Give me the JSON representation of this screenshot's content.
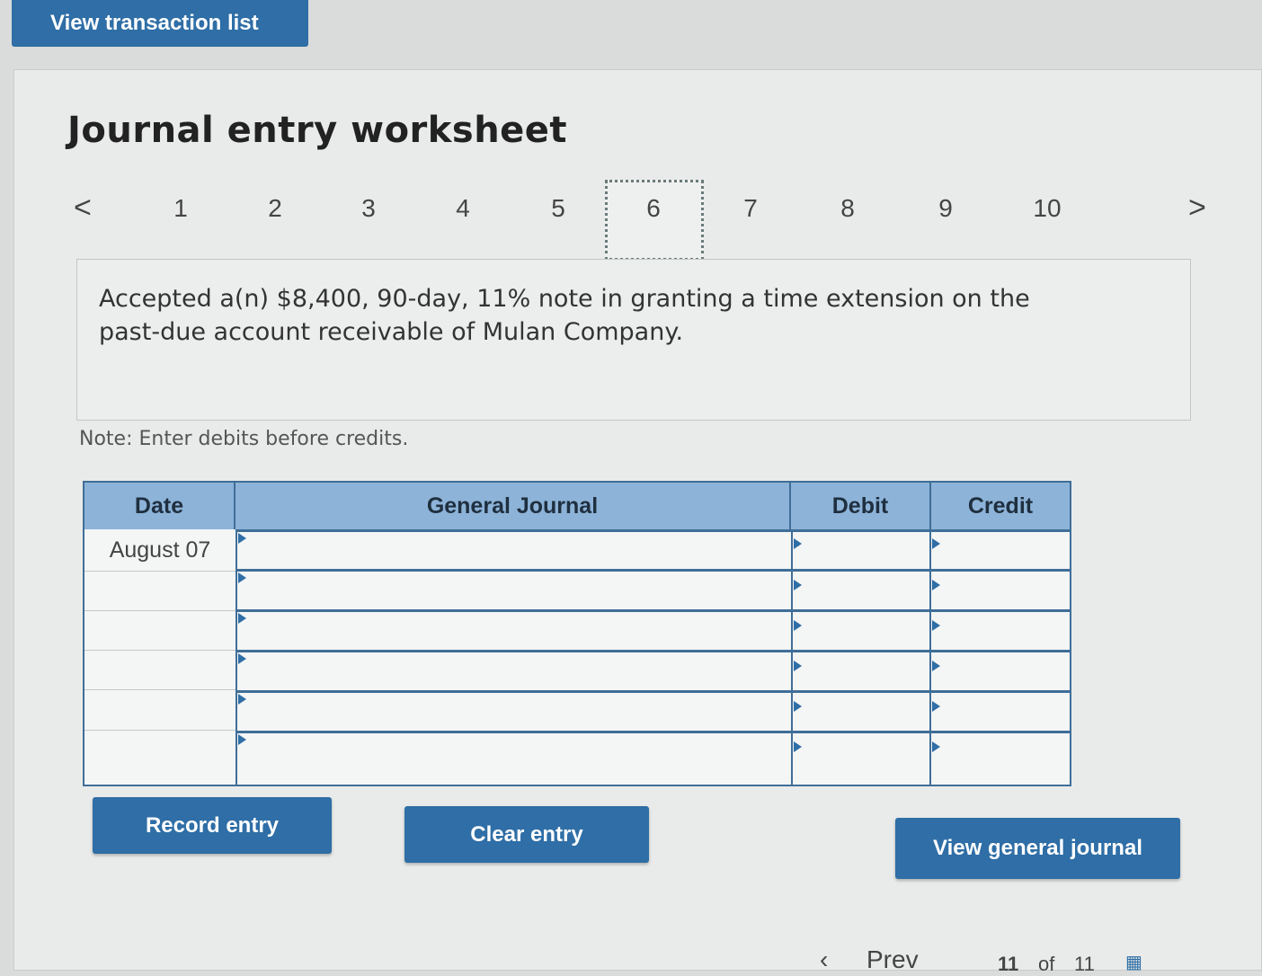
{
  "top_button": "View transaction list",
  "title": "Journal entry worksheet",
  "pager": {
    "prev": "<",
    "next": ">",
    "pages": [
      "1",
      "2",
      "3",
      "4",
      "5",
      "6",
      "7",
      "8",
      "9",
      "10"
    ],
    "active": "6"
  },
  "description": "Accepted a(n) $8,400, 90-day, 11% note in granting a time extension on the past-due account receivable of Mulan Company.",
  "note": "Note: Enter debits before credits.",
  "table": {
    "headers": {
      "date": "Date",
      "journal": "General Journal",
      "debit": "Debit",
      "credit": "Credit"
    },
    "rows": [
      {
        "date": "August 07",
        "journal": "",
        "debit": "",
        "credit": ""
      },
      {
        "date": "",
        "journal": "",
        "debit": "",
        "credit": ""
      },
      {
        "date": "",
        "journal": "",
        "debit": "",
        "credit": ""
      },
      {
        "date": "",
        "journal": "",
        "debit": "",
        "credit": ""
      },
      {
        "date": "",
        "journal": "",
        "debit": "",
        "credit": ""
      },
      {
        "date": "",
        "journal": "",
        "debit": "",
        "credit": ""
      }
    ]
  },
  "buttons": {
    "record": "Record entry",
    "clear": "Clear entry",
    "view_journal": "View general journal"
  },
  "bottom_nav": {
    "prev": "Prev",
    "page_current": "11",
    "page_of": "of",
    "page_total": "11"
  },
  "colors": {
    "accent": "#2f6ea6",
    "header": "#8db3d8"
  }
}
